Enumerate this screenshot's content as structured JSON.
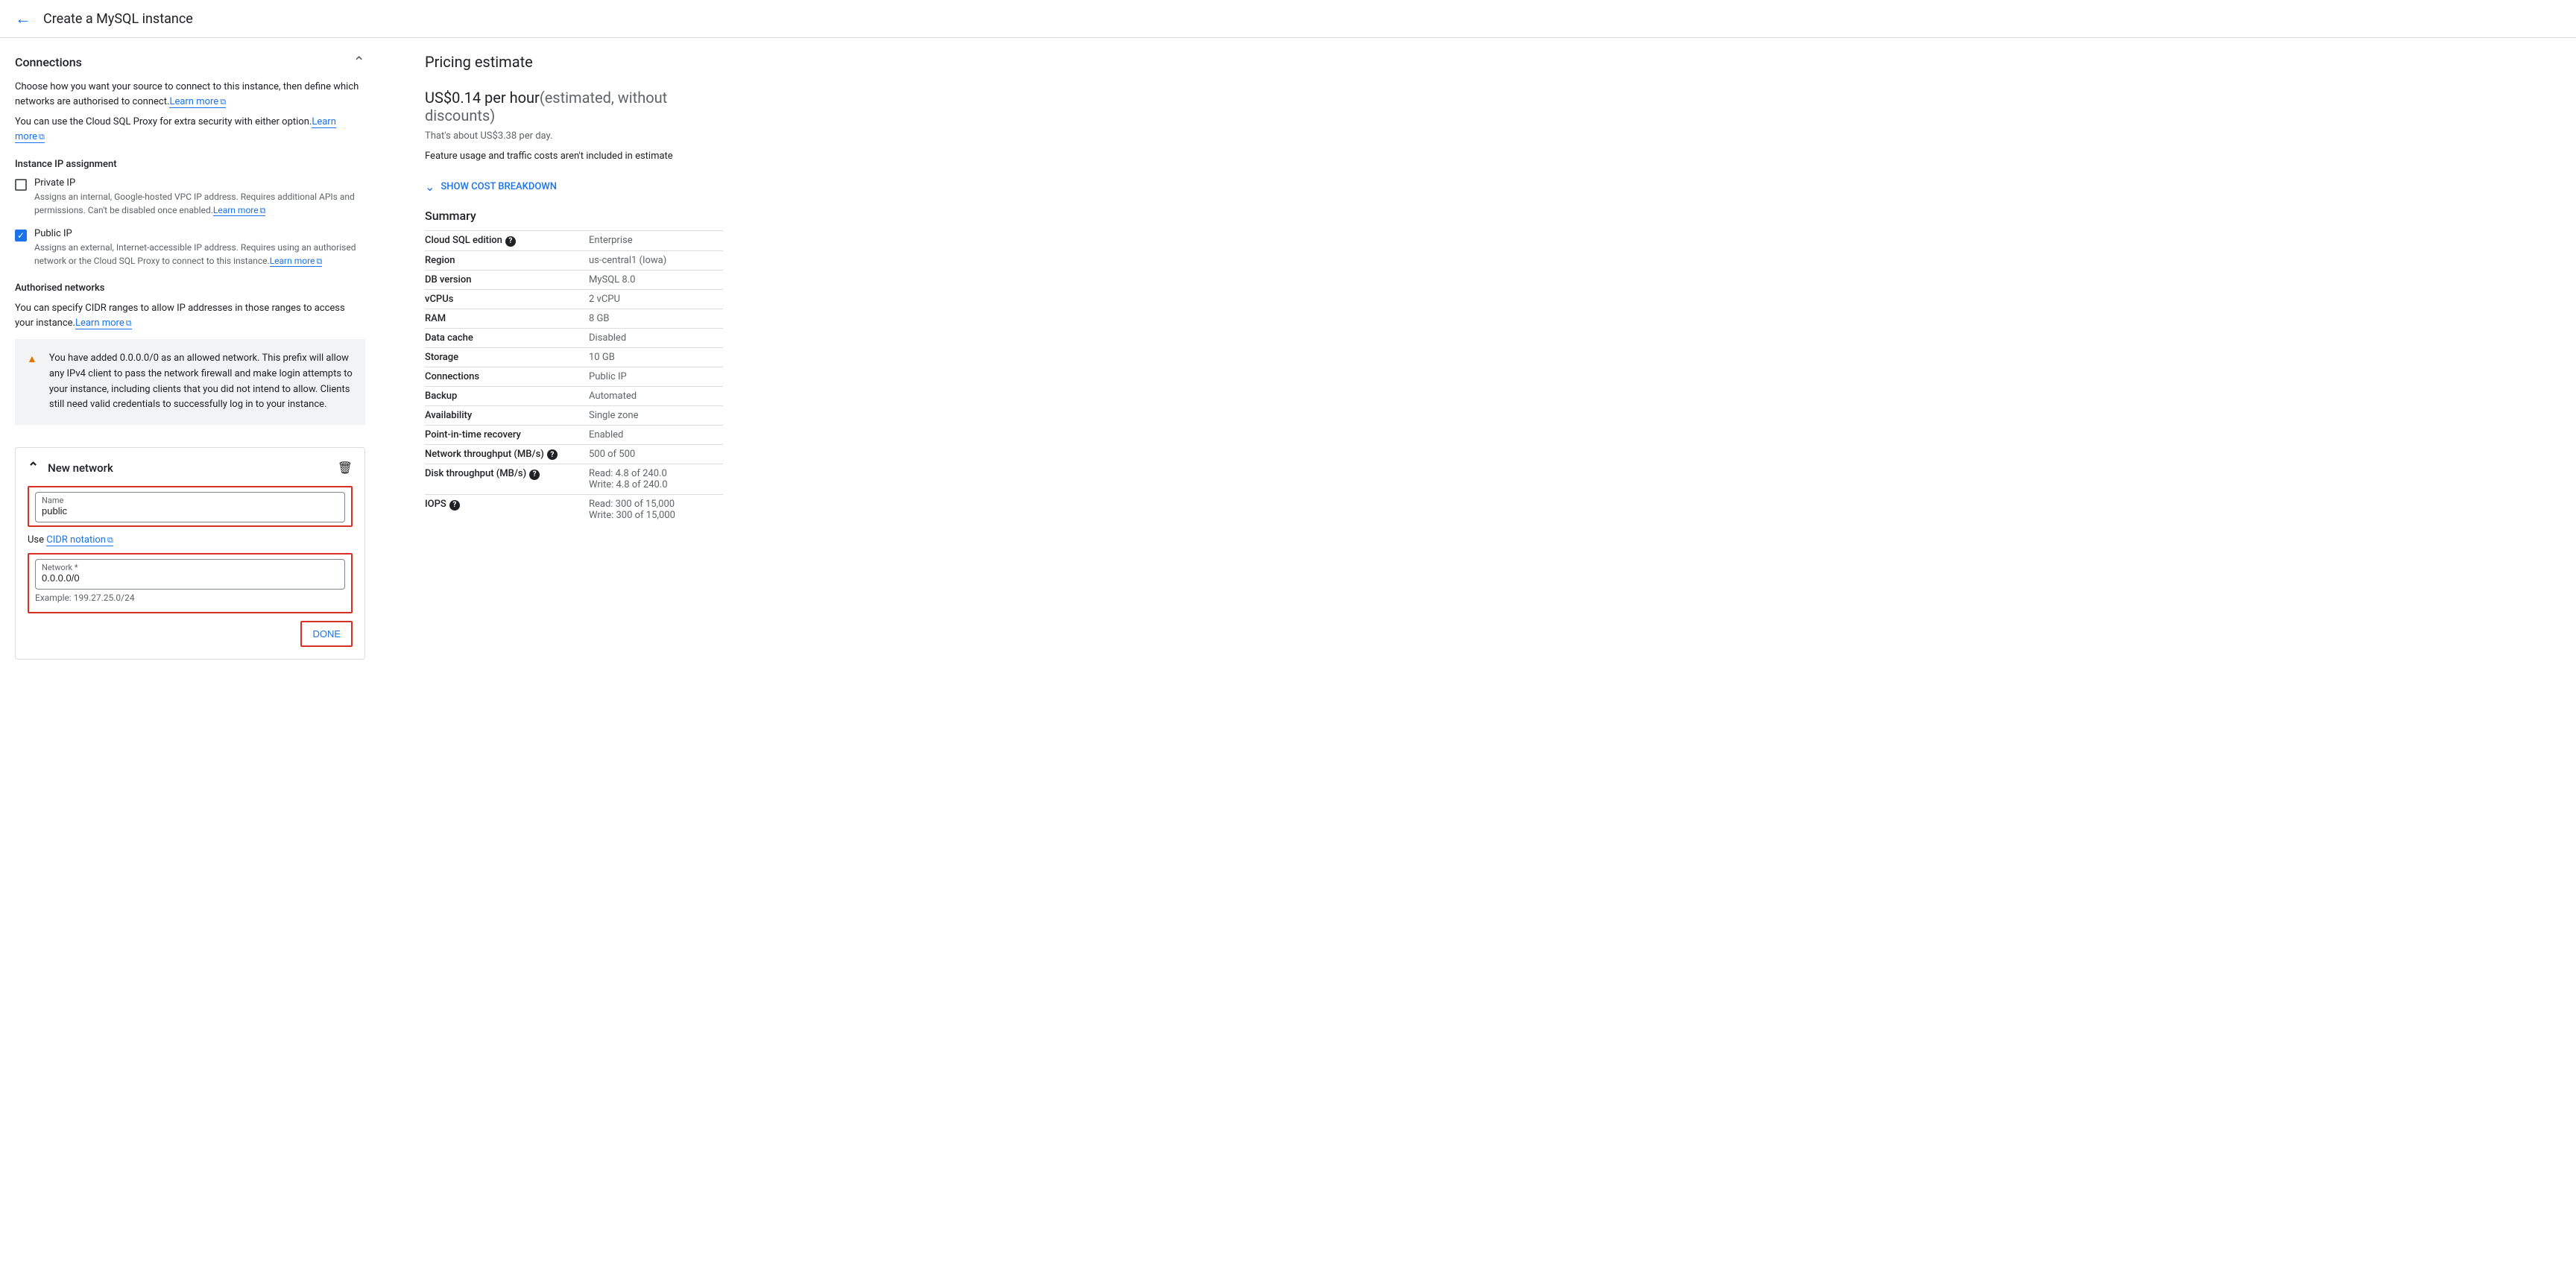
{
  "pageTitle": "Create a MySQL instance",
  "connections": {
    "title": "Connections",
    "desc1_pre": "Choose how you want your source to connect to this instance, then define which networks are authorised to connect.",
    "learn_more": "Learn more",
    "desc2": "You can use the Cloud SQL Proxy for extra security with either option.",
    "ip_assignment_title": "Instance IP assignment",
    "private_ip": {
      "label": "Private IP",
      "desc": "Assigns an internal, Google-hosted VPC IP address. Requires additional APIs and permissions. Can't be disabled once enabled."
    },
    "public_ip": {
      "label": "Public IP",
      "desc": "Assigns an external, Internet-accessible IP address. Requires using an authorised network or the Cloud SQL Proxy to connect to this instance."
    },
    "auth_networks_title": "Authorised networks",
    "auth_networks_desc": "You can specify CIDR ranges to allow IP addresses in those ranges to access your instance.",
    "warning": "You have added 0.0.0.0/0 as an allowed network. This prefix will allow any IPv4 client to pass the network firewall and make login attempts to your instance, including clients that you did not intend to allow. Clients still need valid credentials to successfully log in to your instance.",
    "new_network_title": "New network",
    "name_label": "Name",
    "name_value": "public",
    "use_cidr_pre": "Use ",
    "cidr_link": "CIDR notation",
    "network_label": "Network *",
    "network_value": "0.0.0.0/0",
    "example": "Example: 199.27.25.0/24",
    "done": "DONE"
  },
  "pricing": {
    "title": "Pricing estimate",
    "price": "US$0.14 per hour",
    "price_note": "(estimated, without discounts)",
    "daily": "That's about US$3.38 per day.",
    "feature_note": "Feature usage and traffic costs aren't included in estimate",
    "show_cost": "SHOW COST BREAKDOWN",
    "summary_title": "Summary",
    "rows": [
      {
        "key": "Cloud SQL edition",
        "value": "Enterprise",
        "help": true
      },
      {
        "key": "Region",
        "value": "us-central1 (Iowa)"
      },
      {
        "key": "DB version",
        "value": "MySQL 8.0"
      },
      {
        "key": "vCPUs",
        "value": "2 vCPU"
      },
      {
        "key": "RAM",
        "value": "8 GB"
      },
      {
        "key": "Data cache",
        "value": "Disabled"
      },
      {
        "key": "Storage",
        "value": "10 GB"
      },
      {
        "key": "Connections",
        "value": "Public IP"
      },
      {
        "key": "Backup",
        "value": "Automated"
      },
      {
        "key": "Availability",
        "value": "Single zone"
      },
      {
        "key": "Point-in-time recovery",
        "value": "Enabled"
      },
      {
        "key": "Network throughput (MB/s)",
        "value": "500 of 500",
        "help": true
      },
      {
        "key": "Disk throughput (MB/s)",
        "value": "Read: 4.8 of 240.0",
        "value2": "Write: 4.8 of 240.0",
        "help": true
      },
      {
        "key": "IOPS",
        "value": "Read: 300 of 15,000",
        "value2": "Write: 300 of 15,000",
        "help": true
      }
    ]
  }
}
